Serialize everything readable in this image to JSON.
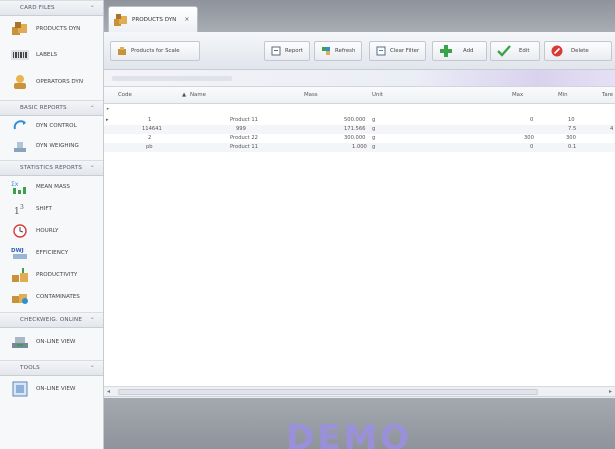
{
  "sidebar": {
    "sections": [
      {
        "title": "CARD FILES",
        "items": [
          {
            "label": "PRODUCTS DYN",
            "icon": "boxes-icon"
          },
          {
            "label": "LABELS",
            "icon": "barcode-icon"
          },
          {
            "label": "OPERATORS DYN",
            "icon": "operator-icon"
          }
        ]
      },
      {
        "title": "BASIC REPORTS",
        "items": [
          {
            "label": "DYN CONTROL",
            "icon": "control-icon"
          },
          {
            "label": "DYN WEIGHING",
            "icon": "weighing-icon"
          }
        ]
      },
      {
        "title": "STATISTICS REPORTS",
        "items": [
          {
            "label": "MEAN MASS",
            "icon": "mean-mass-icon"
          },
          {
            "label": "SHIFT",
            "icon": "shift-icon"
          },
          {
            "label": "HOURLY",
            "icon": "clock-icon"
          },
          {
            "label": "EFFICIENCY",
            "icon": "efficiency-icon"
          },
          {
            "label": "PRODUCTIVITY",
            "icon": "productivity-icon"
          },
          {
            "label": "CONTAMINATES",
            "icon": "contaminates-icon"
          }
        ]
      },
      {
        "title": "CHECKWEIG. ONLINE",
        "items": [
          {
            "label": "ON-LINE VIEW",
            "icon": "online-view-icon"
          }
        ]
      },
      {
        "title": "TOOLS",
        "items": [
          {
            "label": "ON-LINE VIEW",
            "icon": "tools-view-icon"
          }
        ]
      }
    ]
  },
  "tab": {
    "label": "PRODUCTS DYN",
    "close": "×"
  },
  "toolbar": {
    "products_for_scale": "Products for Scale",
    "report": "Report",
    "refresh": "Refresh",
    "clear_filter": "Clear Filter",
    "add": "Add",
    "edit": "Edit",
    "delete": "Delete"
  },
  "grid": {
    "columns": [
      "Code",
      "Name",
      "Mass",
      "Unit",
      "Max",
      "Min",
      "Tare"
    ],
    "rows": [
      {
        "code": "1",
        "name": "Product 11",
        "mass": "500.000",
        "unit": "g",
        "max": "0",
        "min": "10",
        "tare": ""
      },
      {
        "code": "114641",
        "name": "999",
        "mass": "171.566",
        "unit": "g",
        "max": "",
        "min": "7.5",
        "tare": "4"
      },
      {
        "code": "2",
        "name": "Product 22",
        "mass": "300.000",
        "unit": "g",
        "max": "300",
        "min": "300",
        "tare": ""
      },
      {
        "code": "pb",
        "name": "Product 11",
        "mass": "1.000",
        "unit": "g",
        "max": "0",
        "min": "0.1",
        "tare": ""
      }
    ]
  },
  "watermark": "DEMO",
  "colors": {
    "accent": "#9c8fe4",
    "header_bar": "#8e939c"
  }
}
